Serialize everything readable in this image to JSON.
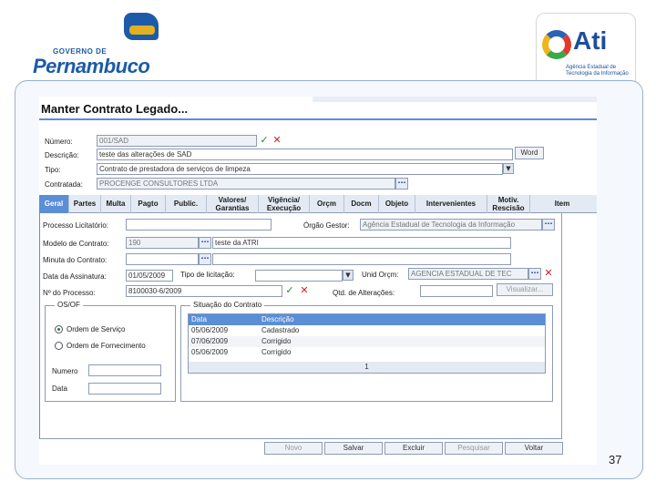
{
  "slide_number": "37",
  "logos": {
    "pernambuco_small": "GOVERNO DE",
    "pernambuco_big": "Pernambuco",
    "ati_word": "Ati",
    "ati_sub": "Agência Estadual de Tecnologia da Informação"
  },
  "app": {
    "title": "Manter Contrato Legado...",
    "header": {
      "numero_label": "Número:",
      "numero_value": "001/SAD",
      "descricao_label": "Descrição:",
      "descricao_value": "teste das alterações de SAD",
      "word_button": "Word",
      "tipo_label": "Tipo:",
      "tipo_value": "Contrato de prestadora de serviços de limpeza",
      "contratada_label": "Contratada:",
      "contratada_value": "PROCENGE CONSULTORES LTDA"
    },
    "tabs": [
      {
        "label": "Geral"
      },
      {
        "label": "Partes"
      },
      {
        "label": "Multa"
      },
      {
        "label": "Pagto"
      },
      {
        "label": "Public."
      },
      {
        "label": "Valores/ Garantias"
      },
      {
        "label": "Vigência/ Execução"
      },
      {
        "label": "Orçm"
      },
      {
        "label": "Docm"
      },
      {
        "label": "Objeto"
      },
      {
        "label": "Intervenientes"
      },
      {
        "label": "Motiv. Rescisão"
      },
      {
        "label": "Item"
      }
    ],
    "geral": {
      "processo_licitatorio_label": "Processo Licitatório:",
      "processo_licitatorio_value": "",
      "orgao_gestor_label": "Órgão Gestor:",
      "orgao_gestor_value": "Agência Estadual de Tecnologia da Informação",
      "modelo_label": "Modelo de Contrato:",
      "modelo_code": "190",
      "modelo_desc": "teste da ATRI",
      "minuta_label": "Minuta do Contrato:",
      "minuta_code": "",
      "minuta_desc": "",
      "data_assinatura_label": "Data da Assinatura:",
      "data_assinatura_value": "01/05/2009",
      "tipo_licitacao_label": "Tipo de licitação:",
      "tipo_licitacao_value": "",
      "unid_orcm_label": "Unid Orçm:",
      "unid_orcm_value": "AGENCIA ESTADUAL DE TEC",
      "nro_processo_label": "Nº do Processo:",
      "nro_processo_value": "8100030-6/2009",
      "qtd_alteracoes_label": "Qtd. de Alterações:",
      "qtd_alteracoes_value": "",
      "visualizar_button": "Visualizar..."
    },
    "os_of": {
      "title": "OS/OF",
      "option_servico": "Ordem de Serviço",
      "option_fornecimento": "Ordem de Fornecimento",
      "numero_label": "Numero",
      "numero_value": "",
      "data_label": "Data",
      "data_value": ""
    },
    "situacao": {
      "title": "Situação do Contrato",
      "columns": [
        "Data",
        "Descrição"
      ],
      "rows": [
        {
          "data": "05/06/2009",
          "descricao": "Cadastrado"
        },
        {
          "data": "07/06/2009",
          "descricao": "Corrigido"
        },
        {
          "data": "05/06/2009",
          "descricao": "Corrigido"
        }
      ],
      "page": "1"
    },
    "actions": {
      "novo": "Novo",
      "salvar": "Salvar",
      "excluir": "Excluir",
      "pesquisar": "Pesquisar",
      "voltar": "Voltar"
    }
  }
}
